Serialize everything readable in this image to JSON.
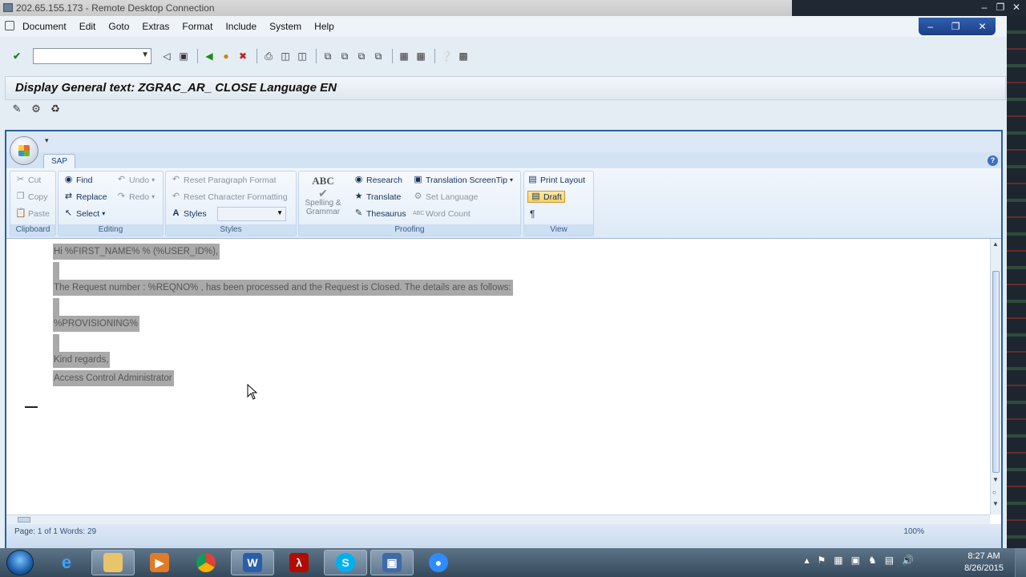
{
  "rdp": {
    "title": "202.65.155.173 - Remote Desktop Connection"
  },
  "menubar": {
    "items": [
      "Document",
      "Edit",
      "Goto",
      "Extras",
      "Format",
      "Include",
      "System",
      "Help"
    ]
  },
  "header": {
    "title": "Display General text: ZGRAC_AR_ CLOSE Language EN"
  },
  "ribbon": {
    "tab": "SAP",
    "clipboard": {
      "label": "Clipboard",
      "cut": "Cut",
      "copy": "Copy",
      "paste": "Paste"
    },
    "editing": {
      "label": "Editing",
      "find": "Find",
      "replace": "Replace",
      "select": "Select",
      "undo": "Undo",
      "redo": "Redo"
    },
    "styles": {
      "label": "Styles",
      "reset_paragraph": "Reset Paragraph Format",
      "reset_character": "Reset Character Formatting",
      "styles": "Styles"
    },
    "proofing": {
      "label": "Proofing",
      "abc": "ABC",
      "spelling_1": "Spelling &",
      "spelling_2": "Grammar",
      "research": "Research",
      "translate": "Translate",
      "thesaurus": "Thesaurus",
      "translation_tip": "Translation ScreenTip",
      "set_language": "Set Language",
      "word_count": "Word Count"
    },
    "view": {
      "label": "View",
      "print_layout": "Print Layout",
      "draft": "Draft",
      "pilcrow": "¶"
    }
  },
  "document": {
    "lines": [
      "Hi %FIRST_NAME% % (%USER_ID%),",
      "The Request number : %REQNO% , has been processed and the Request is Closed. The details are as follows:",
      "%PROVISIONING%",
      "Kind regards,",
      "Access Control Administrator"
    ]
  },
  "status": {
    "text": "Page: 1 of 1   Words: 29",
    "zoom": "100%"
  },
  "taskbar": {
    "time": "8:27 AM",
    "date": "8/26/2015"
  }
}
